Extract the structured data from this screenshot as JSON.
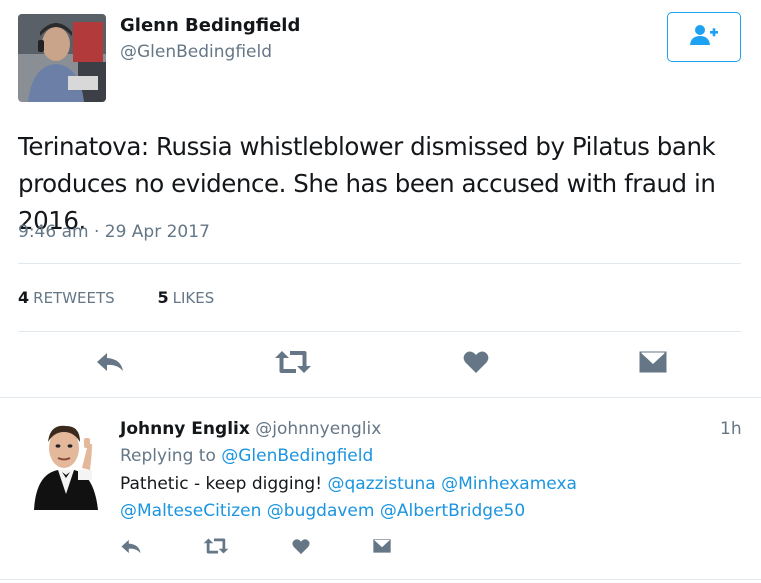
{
  "main_tweet": {
    "author_name": "Glenn Bedingfield",
    "author_handle": "@GlenBedingfield",
    "text_line1": "Terinatova: Russia whistleblower dismissed by Pilatus bank",
    "text_line2": "produces no evidence. She has been accused with fraud in 2016.",
    "timestamp": "9:46 am · 29 Apr 2017",
    "retweets_count": "4",
    "retweets_label": "RETWEETS",
    "likes_count": "5",
    "likes_label": "LIKES",
    "follow_icon": "add-user-icon",
    "actions": [
      "reply-icon",
      "retweet-icon",
      "like-icon",
      "dm-icon"
    ]
  },
  "reply": {
    "author_name": "Johnny Englix",
    "author_handle": "@johnnyenglix",
    "time": "1h",
    "replying_prefix": "Replying to",
    "replying_to": "@GlenBedingfield",
    "text": "Pathetic - keep digging!",
    "mentions_line1": [
      "@qazzistuna",
      "@Minhexamexa"
    ],
    "mentions_line2": [
      "@MalteseCitizen",
      "@bugdavem",
      "@AlbertBridge50"
    ],
    "actions": [
      "reply-icon",
      "retweet-icon",
      "like-icon",
      "dm-icon"
    ]
  },
  "colors": {
    "accent": "#1da1f2",
    "link": "#1b95e0",
    "muted": "#657786",
    "icon": "#657786",
    "divider": "#e1e8ed"
  }
}
